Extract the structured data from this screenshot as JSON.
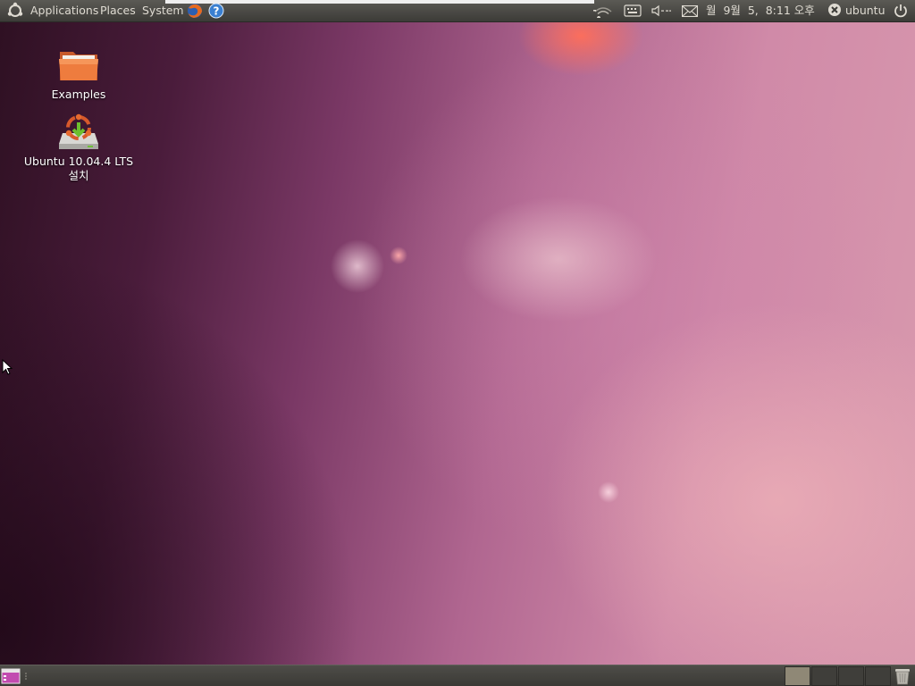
{
  "top_panel": {
    "menus": {
      "applications": "Applications",
      "places": "Places",
      "system": "System"
    },
    "launchers": [
      "firefox-icon",
      "help-icon"
    ],
    "tray_icons": [
      "network-icon",
      "keyboard-icon",
      "volume-icon",
      "mail-icon"
    ],
    "clock": "월  9월  5,  8:11 오후",
    "user": "ubuntu"
  },
  "desktop": {
    "icons": [
      {
        "label": "Examples",
        "icon": "folder-icon"
      },
      {
        "label_line1": "Ubuntu 10.04.4 LTS",
        "label_line2": "설치",
        "icon": "installer-icon"
      }
    ]
  },
  "bottom_panel": {
    "workspaces_count": 4,
    "active_workspace": 1
  },
  "colors": {
    "panel": "#3c3b37",
    "panel_text": "#dfdbd2",
    "folder_orange": "#e8703a",
    "wallpaper_accent": "#b06690"
  }
}
